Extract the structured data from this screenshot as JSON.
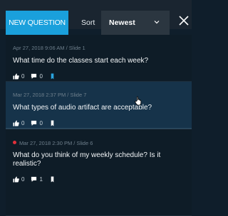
{
  "toolbar": {
    "new_question_label": "NEW QUESTION",
    "sort_label": "Sort",
    "sort_value": "Newest"
  },
  "questions": [
    {
      "meta": "Apr 27, 2018 9:06 AM  /  Slide 1",
      "title": "What time do the classes start each week?",
      "likes": "0",
      "comments": "0",
      "bookmarked": true,
      "bookmark_color": "#2aa5e0"
    },
    {
      "meta": "Mar 27, 2018 2:37 PM  /  Slide 7",
      "title": "What types of audio artifact are acceptable?",
      "likes": "0",
      "comments": "0",
      "bookmarked": false,
      "bookmark_color": "#ffffff"
    },
    {
      "meta": "Mar 27, 2018 2:30 PM  /  Slide 6",
      "title": "What do you think of my weekly schedule? Is it realistic?",
      "likes": "0",
      "comments": "1",
      "bookmarked": false,
      "bookmark_color": "#ffffff",
      "unread": true,
      "unread_color": "#e0303a"
    }
  ],
  "colors": {
    "accent": "#1aa0dc",
    "selected_row": "#16334a",
    "background": "#0e1c27"
  },
  "icons": {
    "like": "thumbs-up-icon",
    "comment": "comment-bubble-icon",
    "bookmark": "bookmark-icon",
    "close": "close-icon",
    "sort_dropdown": "chevron-down-icon"
  }
}
